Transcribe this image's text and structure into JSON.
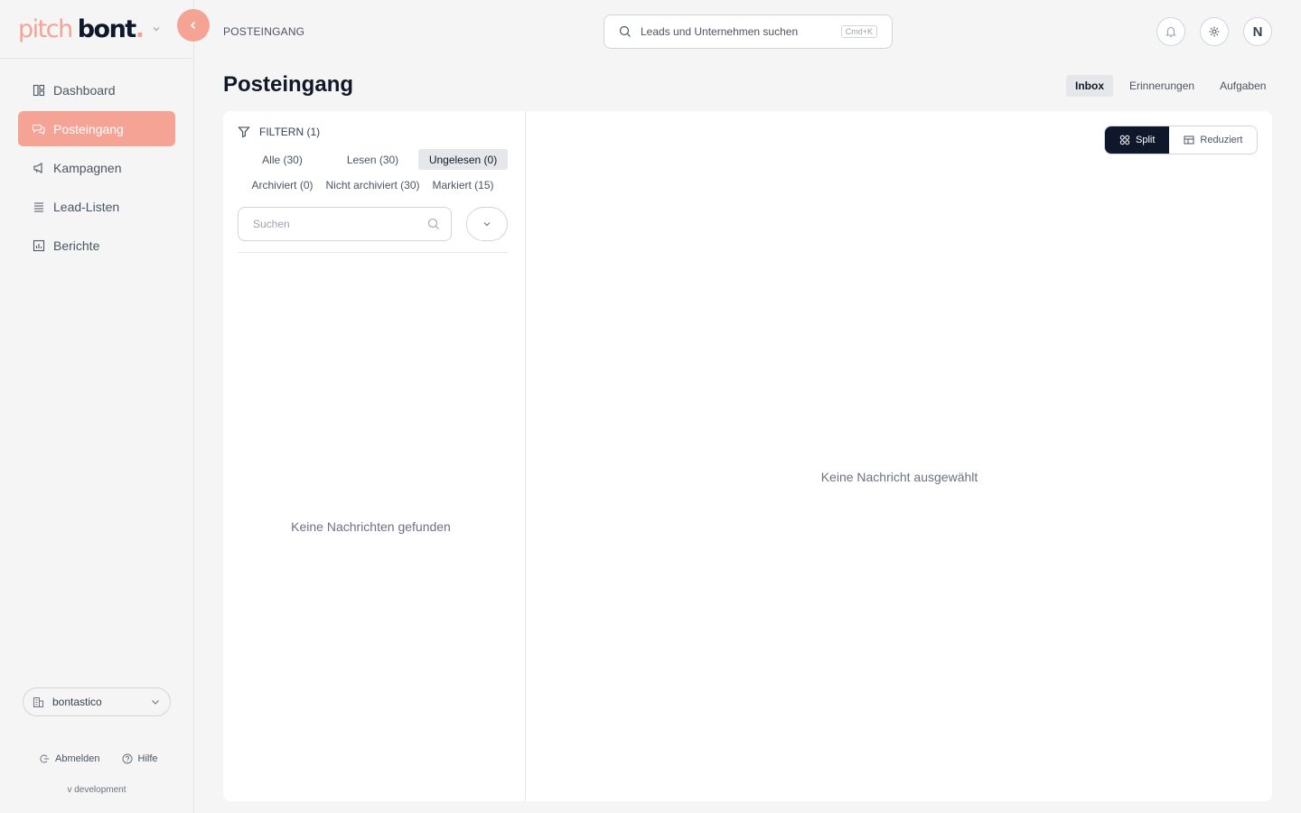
{
  "brand": {
    "part1": "pitch",
    "part2": "bont",
    "dot": ".",
    "accent_color": "#f4a394"
  },
  "sidebar": {
    "items": [
      {
        "label": "Dashboard",
        "icon": "dashboard-icon"
      },
      {
        "label": "Posteingang",
        "icon": "chat-icon",
        "active": true
      },
      {
        "label": "Kampagnen",
        "icon": "megaphone-icon"
      },
      {
        "label": "Lead-Listen",
        "icon": "list-icon"
      },
      {
        "label": "Berichte",
        "icon": "chart-icon"
      }
    ],
    "workspace": "bontastico",
    "logout_label": "Abmelden",
    "help_label": "Hilfe",
    "version": "v development"
  },
  "header": {
    "breadcrumb": "POSTEINGANG",
    "search_placeholder": "Leads und Unternehmen suchen",
    "search_shortcut": "Cmd+K",
    "avatar_initial": "N"
  },
  "page": {
    "title": "Posteingang",
    "tabs": [
      {
        "label": "Inbox",
        "active": true
      },
      {
        "label": "Erinnerungen"
      },
      {
        "label": "Aufgaben"
      }
    ]
  },
  "filters": {
    "title": "FILTERN (1)",
    "chips": [
      {
        "label": "Alle (30)"
      },
      {
        "label": "Lesen (30)"
      },
      {
        "label": "Ungelesen (0)",
        "active": true
      },
      {
        "label": "Archiviert (0)"
      },
      {
        "label": "Nicht archiviert (30)"
      },
      {
        "label": "Markiert (15)"
      }
    ],
    "search_placeholder": "Suchen",
    "empty_text": "Keine Nachrichten gefunden"
  },
  "detail": {
    "split_label": "Split",
    "reduced_label": "Reduziert",
    "empty_text": "Keine Nachricht ausgewählt"
  }
}
